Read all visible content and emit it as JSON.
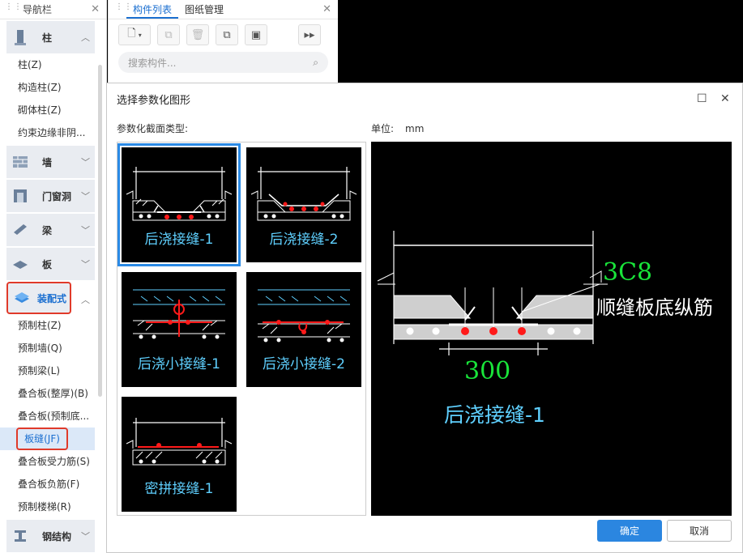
{
  "nav": {
    "title": "导航栏",
    "categories": [
      {
        "label": "柱"
      },
      {
        "label": "墙"
      },
      {
        "label": "门窗洞"
      },
      {
        "label": "梁"
      },
      {
        "label": "板"
      },
      {
        "label": "装配式"
      },
      {
        "label": "钢结构"
      }
    ],
    "column_items": [
      "柱(Z)",
      "构造柱(Z)",
      "砌体柱(Z)",
      "约束边缘非阴..."
    ],
    "assembly_items": [
      "预制柱(Z)",
      "预制墙(Q)",
      "预制梁(L)",
      "叠合板(整厚)(B)",
      "叠合板(预制底...",
      "板缝(JF)",
      "叠合板受力筋(S)",
      "叠合板负筋(F)",
      "预制楼梯(R)"
    ]
  },
  "component_panel": {
    "tabs": [
      "构件列表",
      "图纸管理"
    ],
    "search_placeholder": "搜索构件..."
  },
  "dialog": {
    "title": "选择参数化图形",
    "section_label": "参数化截面类型:",
    "unit_label": "单位:",
    "unit_value": "mm",
    "shapes": [
      "后浇接缝-1",
      "后浇接缝-2",
      "后浇小接缝-1",
      "后浇小接缝-2",
      "密拼接缝-1"
    ],
    "selected_index": 0,
    "preview": {
      "rebar_spec": "3C8",
      "rebar_desc": "顺缝板底纵筋",
      "width_value": "300",
      "name": "后浇接缝-1"
    },
    "ok_label": "确定",
    "cancel_label": "取消"
  },
  "colors": {
    "accent": "#2b86e0",
    "highlight_red": "#e03a2a",
    "cad_cyan": "#5fd0ff",
    "cad_green": "#19e43a",
    "cad_red": "#ff1a1a"
  }
}
